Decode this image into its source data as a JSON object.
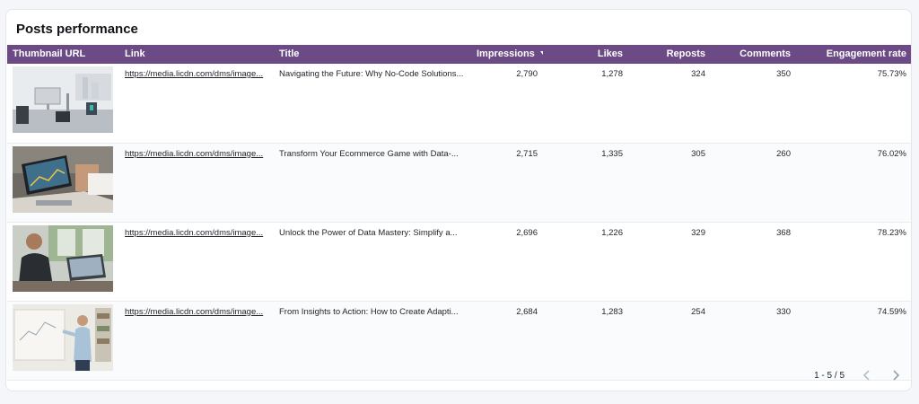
{
  "card": {
    "title": "Posts performance"
  },
  "table": {
    "columns": [
      "Thumbnail URL",
      "Link",
      "Title",
      "Impressions",
      "Likes",
      "Reposts",
      "Comments",
      "Engagement rate"
    ],
    "sorted_column": "Impressions",
    "sort_direction": "descending",
    "header_color": "#6b4a85",
    "rows": [
      {
        "thumbnail": "office-desk-mac-photo",
        "link": "https://media.licdn.com/dms/image...",
        "title": "Navigating the Future: Why No-Code Solutions...",
        "impressions": "2,790",
        "likes": "1,278",
        "reposts": "324",
        "comments": "350",
        "engagement": "75.73%"
      },
      {
        "thumbnail": "laptop-charts-photo",
        "link": "https://media.licdn.com/dms/image...",
        "title": "Transform Your Ecommerce Game with Data-...",
        "impressions": "2,715",
        "likes": "1,335",
        "reposts": "305",
        "comments": "260",
        "engagement": "76.02%"
      },
      {
        "thumbnail": "man-at-laptop-photo",
        "link": "https://media.licdn.com/dms/image...",
        "title": "Unlock the Power of Data Mastery: Simplify a...",
        "impressions": "2,696",
        "likes": "1,226",
        "reposts": "329",
        "comments": "368",
        "engagement": "78.23%"
      },
      {
        "thumbnail": "presenter-whiteboard-photo",
        "link": "https://media.licdn.com/dms/image...",
        "title": "From Insights to Action: How to Create Adapti...",
        "impressions": "2,684",
        "likes": "1,283",
        "reposts": "254",
        "comments": "330",
        "engagement": "74.59%"
      }
    ]
  },
  "pagination": {
    "range_text": "1 - 5 / 5",
    "prev_icon": "chevron-left-icon",
    "next_icon": "chevron-right-icon"
  }
}
